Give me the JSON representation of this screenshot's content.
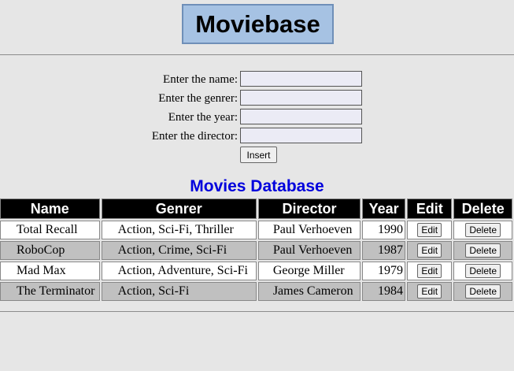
{
  "header": {
    "title": "Moviebase"
  },
  "form": {
    "fields": [
      {
        "label": "Enter the name:",
        "value": ""
      },
      {
        "label": "Enter the genrer:",
        "value": ""
      },
      {
        "label": "Enter the year:",
        "value": ""
      },
      {
        "label": "Enter the director:",
        "value": ""
      }
    ],
    "insert_label": "Insert"
  },
  "database": {
    "title": "Movies Database",
    "columns": [
      "Name",
      "Genrer",
      "Director",
      "Year",
      "Edit",
      "Delete"
    ],
    "rows": [
      {
        "name": "Total Recall",
        "genre": "Action, Sci-Fi, Thriller",
        "director": "Paul Verhoeven",
        "year": "1990",
        "edit": "Edit",
        "delete": "Delete"
      },
      {
        "name": "RoboCop",
        "genre": "Action, Crime, Sci-Fi",
        "director": "Paul Verhoeven",
        "year": "1987",
        "edit": "Edit",
        "delete": "Delete"
      },
      {
        "name": "Mad Max",
        "genre": "Action, Adventure, Sci-Fi",
        "director": "George Miller",
        "year": "1979",
        "edit": "Edit",
        "delete": "Delete"
      },
      {
        "name": "The Terminator",
        "genre": "Action, Sci-Fi",
        "director": "James Cameron",
        "year": "1984",
        "edit": "Edit",
        "delete": "Delete"
      }
    ]
  },
  "colors": {
    "background": "#e6e6e6",
    "title_box": "#a6c2e3",
    "db_title": "#0000dd",
    "header_row": "#000000",
    "alt_row": "#c0c0c0"
  }
}
